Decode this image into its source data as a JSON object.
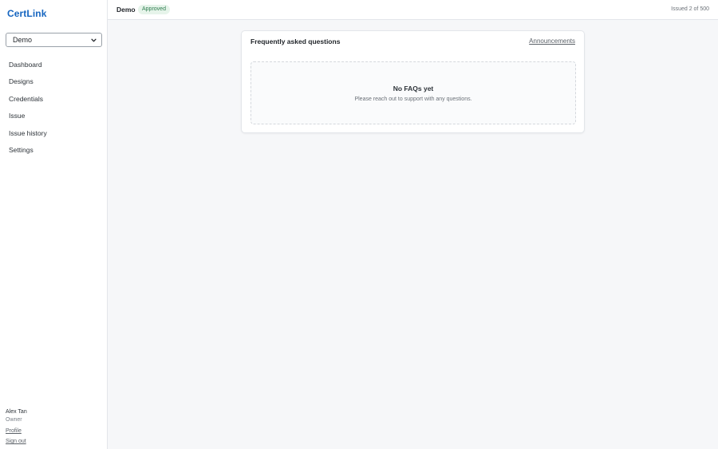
{
  "app": {
    "brand": "CertLink"
  },
  "sidebar": {
    "workspace_select": {
      "selected": "Demo",
      "icon": "chevron-down-icon"
    },
    "nav": [
      {
        "label": "Dashboard"
      },
      {
        "label": "Designs"
      },
      {
        "label": "Credentials"
      },
      {
        "label": "Issue"
      },
      {
        "label": "Issue history"
      },
      {
        "label": "Settings"
      }
    ],
    "user": {
      "name": "Alex Tan",
      "role": "Owner",
      "profile_label": "Profile",
      "signout_label": "Sign out"
    }
  },
  "topbar": {
    "org_name": "Demo",
    "status_badge": "Approved",
    "usage": "Issued 2 of 500"
  },
  "main": {
    "card": {
      "title": "Frequently asked questions",
      "link_label": "Announcements",
      "empty": {
        "title": "No FAQs yet",
        "description": "Please reach out to support with any questions."
      }
    }
  },
  "colors": {
    "brand": "#1565c0",
    "badge_bg": "#e6f4ea",
    "badge_text": "#2e7d4f",
    "page_bg": "#f6f7f9"
  }
}
